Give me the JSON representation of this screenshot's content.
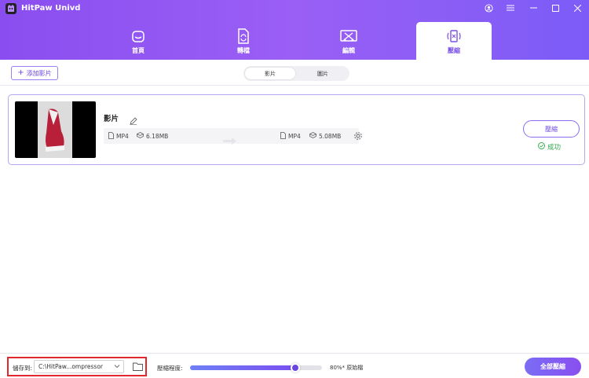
{
  "app": {
    "title": "HitPaw Univd"
  },
  "nav": [
    {
      "label": "首頁",
      "icon": "home-icon"
    },
    {
      "label": "轉檔",
      "icon": "convert-icon"
    },
    {
      "label": "編輯",
      "icon": "edit-tools-icon"
    },
    {
      "label": "壓縮",
      "icon": "compress-icon",
      "active": true
    }
  ],
  "toolbar": {
    "add_label": "添加影片",
    "tabs": [
      "影片",
      "圖片"
    ],
    "active_tab": "影片"
  },
  "file": {
    "title": "影片",
    "source_format": "MP4",
    "source_size": "6.18MB",
    "output_format": "MP4",
    "output_size": "5.08MB",
    "compress_label": "壓縮",
    "status": "成功"
  },
  "bottom": {
    "save_label": "儲存到:",
    "save_path": "C:\\HitPaw...ompressor",
    "level_label": "壓縮程度:",
    "level_value_text": "80%* 原始檔",
    "level_fraction": 0.8,
    "compress_all_label": "全部壓縮"
  },
  "colors": {
    "accent": "#8a4ef0",
    "success": "#2ea84a",
    "highlight": "#e0282f"
  }
}
